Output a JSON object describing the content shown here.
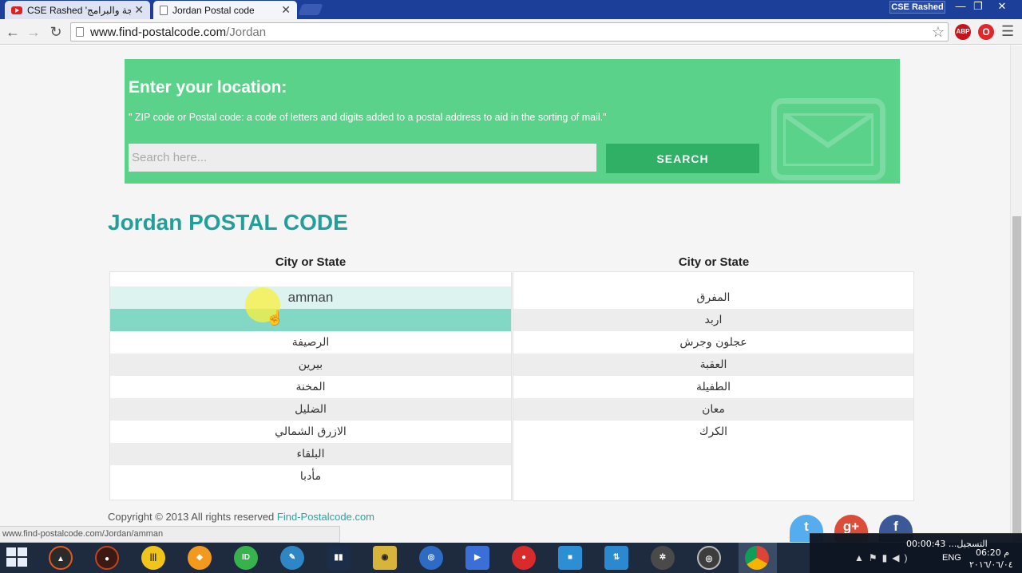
{
  "browser": {
    "tabs": [
      {
        "title": "CSE Rashed 'برمجة والبرامج",
        "active": false
      },
      {
        "title": "Jordan Postal code",
        "active": true
      }
    ],
    "profile_name": "CSE Rashed",
    "url_host": "www.find-postalcode.com",
    "url_path": "/Jordan",
    "extensions": [
      "ABP",
      "O"
    ]
  },
  "hero": {
    "title": "Enter your location:",
    "description": "\" ZIP code or Postal code: a code of letters and digits added to a postal address to aid in the sorting of mail.\"",
    "search_placeholder": "Search here...",
    "search_button": "SEARCH"
  },
  "section_title": "Jordan POSTAL CODE",
  "table": {
    "left_header": "City or State",
    "right_header": "City or State",
    "left_rows": [
      "amman",
      "",
      "الرصيفة",
      "بيرين",
      "المخنة",
      "الضليل",
      "الازرق الشمالي",
      "البلقاء",
      "مأدبا"
    ],
    "right_rows": [
      "المفرق",
      "اربد",
      "عجلون وجرش",
      "العقبة",
      "الطفيلة",
      "معان",
      "الكرك"
    ]
  },
  "footer": {
    "copyright": "Copyright © 2013 All rights reserved ",
    "site_link": "Find-Postalcode.com",
    "social": {
      "twitter": "t",
      "googleplus": "g+",
      "facebook": "f"
    }
  },
  "status_bar": "www.find-postalcode.com/Jordan/amman",
  "taskbar": {
    "recording_text": "التسجيل... 00:00:43",
    "language": "ENG",
    "time": "06:20 م",
    "date": "٢٠١٦/٠٦/٠٤"
  },
  "colors": {
    "hero": "#5bd28a",
    "search_button": "#2fb064",
    "title": "#209f9b",
    "hover_row": "#82d8c4"
  }
}
